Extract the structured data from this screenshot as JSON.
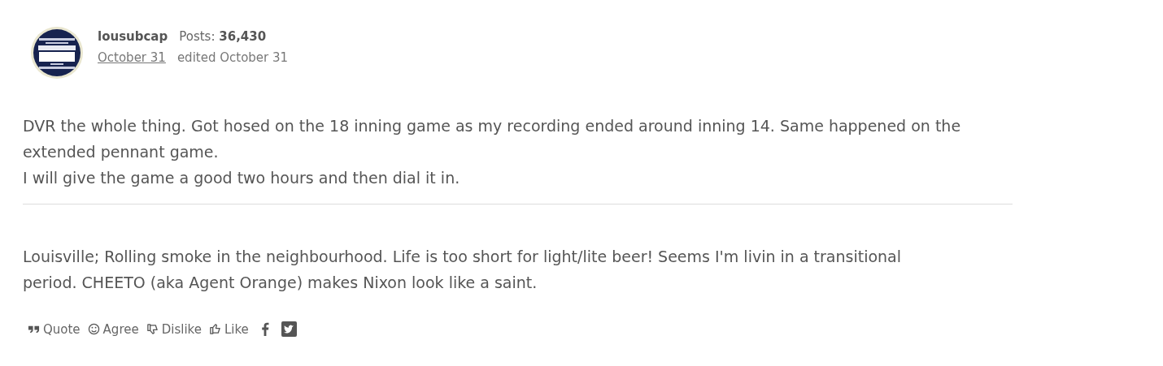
{
  "author": {
    "name": "lousubcap",
    "posts_label": "Posts:",
    "posts": "36,430",
    "date": "October 31",
    "edited": "edited October 31"
  },
  "body": [
    "DVR the whole thing.  Got hosed on the 18 inning game as my recording ended around inning 14.  Same happened on the extended pennant game.",
    "I will give the game a good two hours and then dial it in."
  ],
  "signature": "Louisville; Rolling smoke in the neighbourhood.  Life is too short for light/lite beer!  Seems I'm livin in a transitional period. CHEETO (aka Agent Orange) makes Nixon look like a saint.",
  "reactions": [
    {
      "kind": "quote",
      "label": "Quote"
    },
    {
      "kind": "agree",
      "label": "Agree"
    },
    {
      "kind": "dislike",
      "label": "Dislike"
    },
    {
      "kind": "like",
      "label": "Like"
    },
    {
      "kind": "facebook"
    },
    {
      "kind": "twitter"
    }
  ]
}
